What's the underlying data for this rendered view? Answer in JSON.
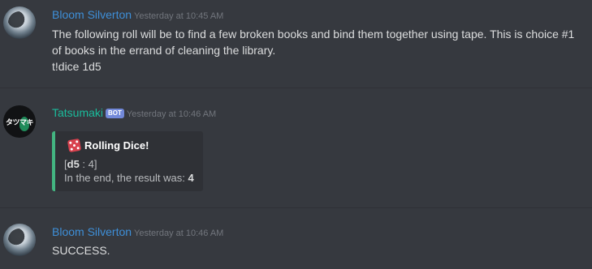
{
  "messages": [
    {
      "author": "Bloom Silverton",
      "timestamp": "Yesterday at 10:45 AM",
      "lines": [
        "The following roll will be to find a few broken books and bind them together using tape. This is choice #1 of books in the errand of cleaning the library.",
        "t!dice 1d5"
      ]
    },
    {
      "author": "Tatsumaki",
      "badge": "BOT",
      "avatar_text": "タツマキ",
      "timestamp": "Yesterday at 10:46 AM",
      "embed": {
        "title": "Rolling Dice!",
        "roll_open": "[",
        "roll_die": "d5",
        "roll_rest": " : 4]",
        "result_prefix": "In the end, the result was: ",
        "result_value": "4",
        "accent_color": "#43b581"
      }
    },
    {
      "author": "Bloom Silverton",
      "timestamp": "Yesterday at 10:46 AM",
      "lines": [
        "SUCCESS."
      ]
    }
  ],
  "colors": {
    "background": "#36393f",
    "bloom_name": "#3e8fd8",
    "tatsu_name": "#1abc9c",
    "bot_badge": "#7289da"
  },
  "icons": {
    "embed_icon": "dice-icon"
  }
}
